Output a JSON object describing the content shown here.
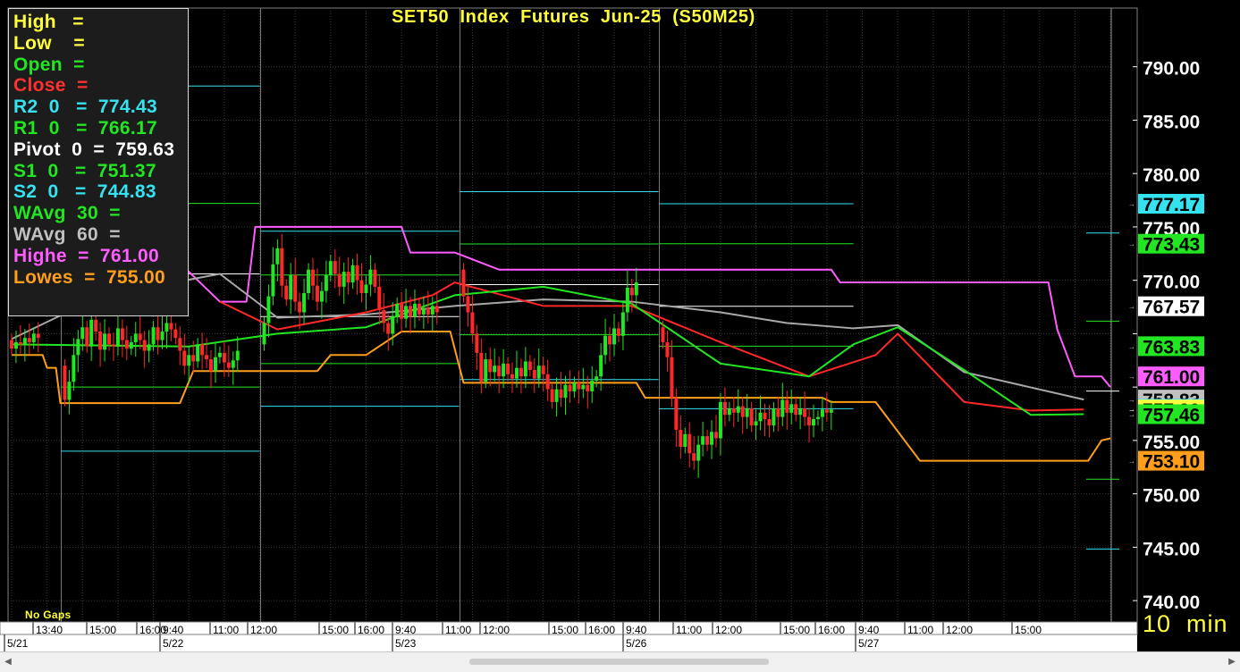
{
  "title": "SET50  Index  Futures  Jun-25  (S50M25)",
  "footer": {
    "no_gaps": "No  Gaps",
    "interval": "10  min"
  },
  "info_box": [
    {
      "label": "High   =",
      "color": "#ffff3c"
    },
    {
      "label": "Low    =",
      "color": "#ffff3c"
    },
    {
      "label": "Open  =",
      "color": "#22e622"
    },
    {
      "label": "Close  =",
      "color": "#ff3030"
    },
    {
      "label": "R2  0   =  774.43",
      "color": "#35e3f0"
    },
    {
      "label": "R1  0   =  766.17",
      "color": "#22e622"
    },
    {
      "label": "Pivot  0  =  759.63",
      "color": "#ffffff"
    },
    {
      "label": "S1  0   =  751.37",
      "color": "#22e622"
    },
    {
      "label": "S2  0   =  744.83",
      "color": "#35e3f0"
    },
    {
      "label": "WAvg  30  =",
      "color": "#22e622"
    },
    {
      "label": "WAvg  60  =",
      "color": "#c0c0c0"
    },
    {
      "label": "Highe  =  761.00",
      "color": "#ff5cff"
    },
    {
      "label": "Lowes  =  755.00",
      "color": "#ff9e1a"
    }
  ],
  "colors": {
    "bull": "#22e622",
    "bear": "#ff2828",
    "grid": "#3a3a3a",
    "axis_text": "#ffffff",
    "pivot": "#ffffff",
    "support_resist_1": "#22e622",
    "support_resist_2": "#35e3f0",
    "wavg30": "#22e622",
    "wavg60": "#a8a8a8",
    "ema": "#ff2828",
    "highest": "#ff5cff",
    "lowest": "#ff9e1a",
    "time_text": "#ffff3c"
  },
  "chart_data": {
    "type": "candlestick",
    "ylim": [
      738.0,
      795.5
    ],
    "y_ticks": [
      740,
      745,
      750,
      755,
      760,
      765,
      770,
      775,
      780,
      785,
      790
    ],
    "y_tick_labels": [
      "740.00",
      "745.00",
      "750.00",
      "755.00",
      "",
      "",
      "770.00",
      "775.00",
      "780.00",
      "785.00",
      "790.00"
    ],
    "x_time_labels": [
      "13:40",
      "15:00",
      "16:00",
      "9:40",
      "11:00",
      "12:00",
      "15:00",
      "16:00",
      "9:40",
      "11:00",
      "12:00",
      "15:00",
      "16:00",
      "9:40",
      "11:00",
      "12:00",
      "15:00",
      "16:00",
      "9:40",
      "11:00",
      "12:00",
      "15:00"
    ],
    "x_date_labels": [
      "5/21",
      "5/22",
      "5/23",
      "5/26",
      "5/27"
    ],
    "price_labels": [
      {
        "value": 777.17,
        "label": "777.17",
        "bg": "#35e3f0",
        "fg": "#000000"
      },
      {
        "value": 773.43,
        "label": "773.43",
        "bg": "#22e622",
        "fg": "#000000"
      },
      {
        "value": 767.57,
        "label": "767.57",
        "bg": "#ffffff",
        "fg": "#000000"
      },
      {
        "value": 763.83,
        "label": "763.83",
        "bg": "#22e622",
        "fg": "#000000"
      },
      {
        "value": 761.0,
        "label": "761.00",
        "bg": "#ff5cff",
        "fg": "#000000"
      },
      {
        "value": 758.83,
        "label": "758.83",
        "bg": "#c0c0c0",
        "fg": "#000000"
      },
      {
        "value": 757.97,
        "label": "757.97",
        "bg": "#35e3f0",
        "fg": "#000000"
      },
      {
        "value": 757.9,
        "label": "757.90",
        "bg": "#ffff3c",
        "fg": "#000000"
      },
      {
        "value": 757.46,
        "label": "757.46",
        "bg": "#22e622",
        "fg": "#000000"
      },
      {
        "value": 753.1,
        "label": "753.10",
        "bg": "#ff9e1a",
        "fg": "#000000"
      }
    ],
    "sessions": [
      {
        "date": "5/21",
        "open_close": [
          [
            764.4,
            763.6
          ],
          [
            763.6,
            764.2
          ],
          [
            764.2,
            764.0
          ],
          [
            764.0,
            764.6
          ],
          [
            764.6,
            764.2
          ],
          [
            764.2,
            765.0
          ],
          [
            765.0,
            764.6
          ]
        ]
      },
      {
        "date": "5/22",
        "open_close": [
          [
            762.0,
            758.8
          ],
          [
            758.8,
            760.5
          ],
          [
            760.5,
            763.0
          ],
          [
            763.0,
            764.5
          ],
          [
            764.5,
            765.6
          ],
          [
            765.6,
            763.8
          ],
          [
            763.8,
            766.3
          ],
          [
            766.3,
            765.2
          ],
          [
            765.2,
            763.5
          ],
          [
            763.5,
            765.0
          ],
          [
            765.0,
            764.0
          ],
          [
            764.0,
            763.8
          ],
          [
            763.8,
            765.5
          ],
          [
            765.5,
            764.4
          ],
          [
            764.4,
            763.6
          ],
          [
            763.6,
            764.2
          ],
          [
            764.2,
            765.0
          ],
          [
            765.0,
            764.4
          ],
          [
            764.4,
            763.4
          ],
          [
            763.4,
            764.0
          ],
          [
            764.0,
            765.6
          ],
          [
            765.6,
            764.4
          ],
          [
            764.4,
            765.2
          ],
          [
            765.2,
            766.0
          ],
          [
            766.0,
            765.4
          ],
          [
            765.4,
            764.6
          ],
          [
            764.6,
            763.4
          ],
          [
            763.4,
            762.0
          ],
          [
            762.0,
            763.0
          ],
          [
            763.0,
            762.4
          ],
          [
            762.4,
            764.0
          ],
          [
            764.0,
            763.0
          ],
          [
            763.0,
            762.6
          ],
          [
            762.6,
            761.5
          ],
          [
            761.5,
            762.8
          ],
          [
            762.8,
            763.2
          ],
          [
            763.2,
            762.3
          ],
          [
            762.3,
            761.8
          ],
          [
            761.8,
            762.5
          ],
          [
            762.5,
            763.4
          ]
        ]
      },
      {
        "date": "5/23",
        "open_close": [
          [
            764.0,
            766.0
          ],
          [
            766.0,
            768.5
          ],
          [
            768.5,
            771.5
          ],
          [
            771.5,
            773.0
          ],
          [
            773.0,
            769.5
          ],
          [
            769.5,
            768.2
          ],
          [
            768.2,
            770.5
          ],
          [
            770.5,
            768.0
          ],
          [
            768.0,
            767.0
          ],
          [
            767.0,
            768.8
          ],
          [
            768.8,
            771.0
          ],
          [
            771.0,
            769.5
          ],
          [
            769.5,
            768.0
          ],
          [
            768.0,
            769.0
          ],
          [
            769.0,
            770.5
          ],
          [
            770.5,
            771.8
          ],
          [
            771.8,
            770.6
          ],
          [
            770.6,
            769.4
          ],
          [
            769.4,
            770.8
          ],
          [
            770.8,
            769.8
          ],
          [
            769.8,
            771.4
          ],
          [
            771.4,
            770.0
          ],
          [
            770.0,
            768.8
          ],
          [
            768.8,
            769.6
          ],
          [
            769.6,
            771.0
          ],
          [
            771.0,
            769.4
          ],
          [
            769.4,
            767.2
          ],
          [
            767.2,
            766.0
          ],
          [
            766.0,
            765.0
          ],
          [
            765.0,
            766.6
          ],
          [
            766.6,
            767.8
          ],
          [
            767.8,
            766.4
          ],
          [
            766.4,
            767.6
          ],
          [
            767.6,
            766.6
          ],
          [
            766.6,
            767.8
          ],
          [
            767.8,
            766.8
          ],
          [
            766.8,
            767.4
          ],
          [
            767.4,
            766.8
          ],
          [
            766.8,
            767.6
          ],
          [
            767.6,
            767.0
          ]
        ]
      },
      {
        "date": "5/26",
        "open_close": [
          [
            771.0,
            768.5
          ],
          [
            768.5,
            767.0
          ],
          [
            767.0,
            765.0
          ],
          [
            765.0,
            763.2
          ],
          [
            763.2,
            760.5
          ],
          [
            760.5,
            762.6
          ],
          [
            762.6,
            761.4
          ],
          [
            761.4,
            762.0
          ],
          [
            762.0,
            761.0
          ],
          [
            761.0,
            762.2
          ],
          [
            762.2,
            761.2
          ],
          [
            761.2,
            760.8
          ],
          [
            760.8,
            761.8
          ],
          [
            761.8,
            761.0
          ],
          [
            761.0,
            762.4
          ],
          [
            762.4,
            761.6
          ],
          [
            761.6,
            760.8
          ],
          [
            760.8,
            762.0
          ],
          [
            762.0,
            761.2
          ],
          [
            761.2,
            759.8
          ],
          [
            759.8,
            758.6
          ],
          [
            758.6,
            759.8
          ],
          [
            759.8,
            759.0
          ],
          [
            759.0,
            760.2
          ],
          [
            760.2,
            759.6
          ],
          [
            759.6,
            760.4
          ],
          [
            760.4,
            759.8
          ],
          [
            759.8,
            760.2
          ],
          [
            760.2,
            759.6
          ],
          [
            759.6,
            760.6
          ],
          [
            760.6,
            761.0
          ],
          [
            761.0,
            763.0
          ],
          [
            763.0,
            764.8
          ],
          [
            764.8,
            764.0
          ],
          [
            764.0,
            765.5
          ],
          [
            765.5,
            764.8
          ],
          [
            764.8,
            767.0
          ],
          [
            767.0,
            769.3
          ],
          [
            769.3,
            768.6
          ],
          [
            768.6,
            769.8
          ]
        ]
      },
      {
        "date": "5/27",
        "open_close": [
          [
            765.6,
            764.2
          ],
          [
            764.2,
            762.8
          ],
          [
            762.8,
            759.0
          ],
          [
            759.0,
            756.0
          ],
          [
            756.0,
            754.4
          ],
          [
            754.4,
            755.6
          ],
          [
            755.6,
            753.8
          ],
          [
            753.8,
            753.1
          ],
          [
            753.1,
            754.6
          ],
          [
            754.6,
            755.4
          ],
          [
            755.4,
            754.6
          ],
          [
            754.6,
            755.8
          ],
          [
            755.8,
            755.2
          ],
          [
            755.2,
            758.6
          ],
          [
            758.6,
            757.4
          ],
          [
            757.4,
            758.0
          ],
          [
            758.0,
            757.6
          ],
          [
            757.6,
            758.2
          ],
          [
            758.2,
            757.2
          ],
          [
            757.2,
            758.0
          ],
          [
            758.0,
            756.4
          ],
          [
            756.4,
            756.8
          ],
          [
            756.8,
            757.6
          ],
          [
            757.6,
            757.0
          ],
          [
            757.0,
            756.4
          ],
          [
            756.4,
            758.0
          ],
          [
            758.0,
            757.2
          ],
          [
            757.2,
            758.8
          ],
          [
            758.8,
            757.6
          ],
          [
            757.6,
            758.4
          ],
          [
            758.4,
            757.4
          ],
          [
            757.4,
            758.0
          ],
          [
            758.0,
            757.2
          ],
          [
            757.2,
            756.4
          ],
          [
            756.4,
            757.0
          ],
          [
            757.0,
            757.2
          ],
          [
            757.2,
            757.9
          ],
          [
            757.9,
            757.6
          ],
          [
            757.6,
            757.9
          ]
        ]
      }
    ],
    "pivot_levels": [
      {
        "session": "5/22",
        "R2": 788.2,
        "R1": 777.2,
        "Pivot": 770.6,
        "S1": 760.0,
        "S2": 754.0
      },
      {
        "session": "5/23",
        "R2": 774.6,
        "R1": 770.5,
        "Pivot": 766.6,
        "S1": 762.2,
        "S2": 758.2
      },
      {
        "session": "5/26",
        "R2": 778.3,
        "R1": 773.4,
        "Pivot": 769.6,
        "S1": 764.9,
        "S2": 760.7
      },
      {
        "session": "5/27",
        "R2": 777.17,
        "R1": 773.43,
        "Pivot": 767.57,
        "S1": 763.83,
        "S2": 757.97
      },
      {
        "session": "next",
        "R2": 774.43,
        "R1": 766.17,
        "Pivot": 759.63,
        "S1": 751.37,
        "S2": 744.83
      }
    ],
    "series_wavg30": [
      [
        0,
        764.0
      ],
      [
        40,
        763.8
      ],
      [
        60,
        765.0
      ],
      [
        80,
        765.6
      ],
      [
        100,
        768.6
      ],
      [
        120,
        769.4
      ],
      [
        140,
        767.8
      ],
      [
        160,
        762.2
      ],
      [
        180,
        761.0
      ],
      [
        190,
        764.0
      ],
      [
        200,
        765.6
      ],
      [
        215,
        761.6
      ],
      [
        230,
        757.4
      ],
      [
        242,
        757.46
      ]
    ],
    "series_wavg60": [
      [
        0,
        764.5
      ],
      [
        20,
        768.5
      ],
      [
        47,
        770.6
      ],
      [
        60,
        766.5
      ],
      [
        80,
        766.8
      ],
      [
        100,
        767.6
      ],
      [
        120,
        768.2
      ],
      [
        140,
        768.0
      ],
      [
        160,
        767.0
      ],
      [
        175,
        766.0
      ],
      [
        190,
        765.5
      ],
      [
        200,
        765.8
      ],
      [
        215,
        761.4
      ],
      [
        242,
        758.83
      ]
    ],
    "series_ema": [
      [
        47,
        768.0
      ],
      [
        60,
        765.4
      ],
      [
        80,
        767.0
      ],
      [
        95,
        768.6
      ],
      [
        100,
        769.8
      ],
      [
        120,
        767.6
      ],
      [
        140,
        767.6
      ],
      [
        160,
        764.2
      ],
      [
        180,
        761.0
      ],
      [
        195,
        763.0
      ],
      [
        200,
        765.0
      ],
      [
        215,
        758.6
      ],
      [
        230,
        757.8
      ],
      [
        242,
        757.9
      ]
    ],
    "series_highest": [
      [
        7,
        779.6
      ],
      [
        10,
        778.8
      ],
      [
        15,
        776.4
      ],
      [
        19,
        772.0
      ],
      [
        37,
        772.0
      ],
      [
        47,
        768.0
      ],
      [
        53,
        768.0
      ],
      [
        55,
        775.0
      ],
      [
        88,
        775.0
      ],
      [
        90,
        772.6
      ],
      [
        100,
        772.6
      ],
      [
        110,
        771.0
      ],
      [
        145,
        771.0
      ],
      [
        185,
        771.0
      ],
      [
        187,
        769.8
      ],
      [
        200,
        769.8
      ],
      [
        234,
        769.8
      ],
      [
        236,
        765.4
      ],
      [
        240,
        761.0
      ],
      [
        246,
        761.0
      ],
      [
        248,
        760.0
      ]
    ],
    "series_lowest": [
      [
        0,
        763.0
      ],
      [
        7,
        763.0
      ],
      [
        8,
        761.8
      ],
      [
        10,
        761.8
      ],
      [
        11,
        758.5
      ],
      [
        38,
        758.5
      ],
      [
        41,
        761.5
      ],
      [
        69,
        761.5
      ],
      [
        72,
        763.0
      ],
      [
        80,
        763.0
      ],
      [
        88,
        765.2
      ],
      [
        99,
        765.2
      ],
      [
        102,
        760.4
      ],
      [
        141,
        760.4
      ],
      [
        143,
        759.0
      ],
      [
        183,
        759.0
      ],
      [
        185,
        758.6
      ],
      [
        195,
        758.6
      ],
      [
        199,
        756.4
      ],
      [
        205,
        753.1
      ],
      [
        243,
        753.1
      ],
      [
        246,
        755.0
      ],
      [
        248,
        755.2
      ]
    ]
  }
}
